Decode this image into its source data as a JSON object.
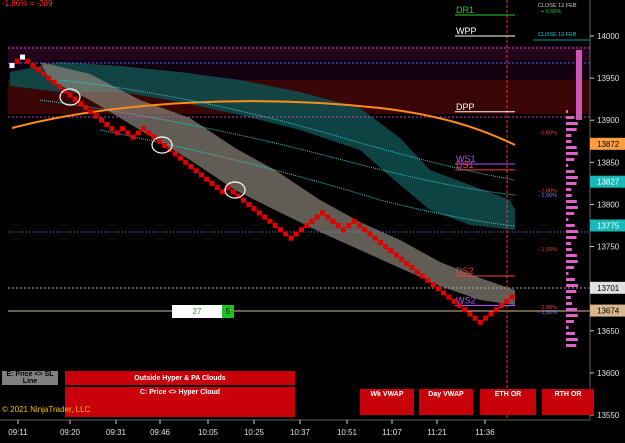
{
  "header": {
    "pnl_text": "-1,86% = -289",
    "close_12": "CLOSE 12 FEB",
    "close_12_change": "+ 0,50%",
    "close_19": "CLOSE 19 FEB"
  },
  "footer": {
    "copyright": "© 2021 NinjaTrader, LLC"
  },
  "buttons": {
    "price_sl": "E: Price <> SL Line",
    "outside_hyper": "Outside Hyper & PA Clouds",
    "price_hyper": "C: Price <> Hyper Cloud",
    "wk_vwap": "Wk VWAP",
    "day_vwap": "Day VWAP",
    "eth_or": "ETH OR",
    "rth_or": "RTH OR"
  },
  "counter": {
    "value": "27",
    "badge": "5"
  },
  "colors": {
    "background": "#000000",
    "price_box": "#e00000",
    "price_box_light": "#ffffff",
    "hyper_cloud": "#8a8578",
    "teal_cloud": "#0f4a4a",
    "red_zone": "#3a0505",
    "orange_curve": "#ff8c1a",
    "cyan_line": "#34c8c8",
    "price_tag_orange": "#ffa040",
    "price_tag_teal": "#18b8b8",
    "price_tag_grey": "#e0e0e0",
    "price_tag_tan": "#d8b890",
    "pink_volume": "#e060c8",
    "level_label_green": "#22cc22",
    "level_label_red": "#ff3a3a",
    "level_label_purple": "#b050ff"
  },
  "chart_data": {
    "type": "renko",
    "y_axis": {
      "ylim": [
        13540,
        14020
      ],
      "ticks": [
        14000,
        13950,
        13900,
        13850,
        13800,
        13750,
        13700,
        13650,
        13600,
        13550
      ]
    },
    "x_axis": {
      "ticks": [
        "09:11",
        "09:20",
        "09:31",
        "09:46",
        "10:05",
        "10:25",
        "10:37",
        "10:51",
        "11:07",
        "11:21",
        "11:36"
      ]
    },
    "brick_size": 5,
    "bricks": [
      13965,
      13970,
      13975,
      13970,
      13965,
      13960,
      13955,
      13950,
      13945,
      13940,
      13935,
      13930,
      13925,
      13920,
      13915,
      13910,
      13905,
      13900,
      13895,
      13890,
      13885,
      13890,
      13885,
      13880,
      13885,
      13890,
      13885,
      13880,
      13875,
      13870,
      13865,
      13860,
      13855,
      13850,
      13845,
      13840,
      13835,
      13830,
      13825,
      13820,
      13815,
      13820,
      13815,
      13810,
      13805,
      13800,
      13795,
      13790,
      13785,
      13780,
      13775,
      13770,
      13765,
      13760,
      13765,
      13770,
      13775,
      13780,
      13785,
      13790,
      13785,
      13780,
      13775,
      13770,
      13775,
      13780,
      13775,
      13770,
      13765,
      13760,
      13755,
      13750,
      13745,
      13740,
      13735,
      13730,
      13725,
      13720,
      13715,
      13710,
      13705,
      13700,
      13695,
      13690,
      13685,
      13680,
      13675,
      13670,
      13665,
      13660,
      13665,
      13670,
      13675,
      13680,
      13685,
      13690
    ],
    "price_tags": [
      {
        "label": "13872",
        "value": 13872,
        "color": "#ffa040",
        "text_color": "#000000"
      },
      {
        "label": "13827",
        "value": 13827,
        "color": "#18b8b8",
        "text_color": "#ffffff"
      },
      {
        "label": "13775",
        "value": 13775,
        "color": "#18b8b8",
        "text_color": "#ffffff"
      },
      {
        "label": "13701",
        "value": 13701,
        "color": "#e0e0e0",
        "text_color": "#000000"
      },
      {
        "label": "13674",
        "value": 13674,
        "color": "#d8b890",
        "text_color": "#000000"
      }
    ],
    "levels": [
      {
        "name": "DR1",
        "value": 14025,
        "color": "#22cc22"
      },
      {
        "name": "WPP",
        "value": 14000,
        "color": "#ffffff"
      },
      {
        "name": "DPP",
        "value": 13910,
        "color": "#ffffff"
      },
      {
        "name": "WS1",
        "value": 13848,
        "color": "#b050ff"
      },
      {
        "name": "DS1",
        "value": 13841,
        "color": "#ff3a3a"
      },
      {
        "name": "DS2",
        "value": 13715,
        "color": "#ff3a3a"
      },
      {
        "name": "WS2",
        "value": 13680,
        "color": "#b050ff"
      }
    ],
    "annotations": [
      {
        "text": "- 0,50%",
        "value": 13883,
        "color": "#ff3a3a"
      },
      {
        "text": "- 1,00%",
        "value": 13814,
        "color": "#ff3a3a"
      },
      {
        "text": "- 1,00%",
        "value": 13809,
        "color": "#7080ff"
      },
      {
        "text": "- 1,50%",
        "value": 13745,
        "color": "#ff3a3a"
      },
      {
        "text": "- 2,00%",
        "value": 13676,
        "color": "#ff3a3a"
      },
      {
        "text": "- 2,00%",
        "value": 13670,
        "color": "#7080ff"
      }
    ]
  }
}
